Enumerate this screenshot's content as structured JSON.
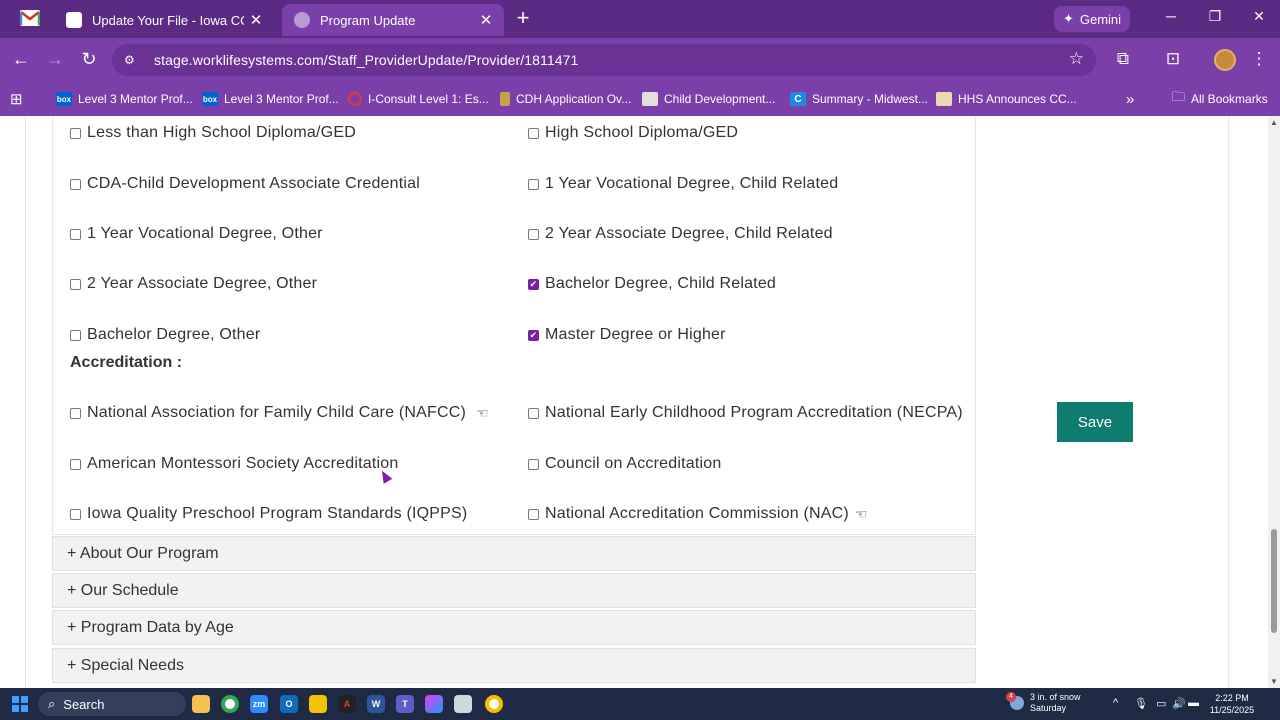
{
  "browser": {
    "tabs": [
      {
        "title": "Update Your File - Iowa CCR&R",
        "active": false
      },
      {
        "title": "Program Update",
        "active": true
      }
    ],
    "gemini_label": "Gemini",
    "url": "stage.worklifesystems.com/Staff_ProviderUpdate/Provider/1811471",
    "bookmarks": [
      "Level 3 Mentor Prof...",
      "Level 3 Mentor Prof...",
      "I-Consult Level 1: Es...",
      "CDH Application Ov...",
      "Child Development...",
      "Summary - Midwest...",
      "HHS Announces CC..."
    ],
    "all_bookmarks_label": "All Bookmarks"
  },
  "education": {
    "options": [
      {
        "label": "Less than High School Diploma/GED",
        "checked": false
      },
      {
        "label": "High School Diploma/GED",
        "checked": false
      },
      {
        "label": "CDA-Child Development Associate Credential",
        "checked": false
      },
      {
        "label": "1 Year Vocational Degree, Child Related",
        "checked": false
      },
      {
        "label": "1 Year Vocational Degree, Other",
        "checked": false
      },
      {
        "label": "2 Year Associate Degree, Child Related",
        "checked": false
      },
      {
        "label": "2 Year Associate Degree, Other",
        "checked": false
      },
      {
        "label": "Bachelor Degree, Child Related",
        "checked": true
      },
      {
        "label": "Bachelor Degree, Other",
        "checked": false
      },
      {
        "label": "Master Degree or Higher",
        "checked": true
      }
    ]
  },
  "accreditation": {
    "label": "Accreditation :",
    "options": [
      {
        "label": "National Association for Family Child Care (NAFCC)",
        "checked": false
      },
      {
        "label": "National Early Childhood Program Accreditation (NECPA)",
        "checked": false
      },
      {
        "label": "American Montessori Society Accreditation",
        "checked": false
      },
      {
        "label": "Council on Accreditation",
        "checked": false
      },
      {
        "label": "Iowa Quality Preschool Program Standards (IQPPS)",
        "checked": false
      },
      {
        "label": "National Accreditation Commission (NAC)",
        "checked": false
      }
    ]
  },
  "sections": [
    "+ About Our Program",
    "+ Our Schedule",
    "+ Program Data by Age",
    "+ Special Needs"
  ],
  "save_label": "Save",
  "taskbar": {
    "search_label": "Search",
    "weather": {
      "line1": "3 in. of snow",
      "line2": "Saturday",
      "badge": "4"
    },
    "clock": {
      "time": "2:22 PM",
      "date": "11/25/2025"
    }
  },
  "colors": {
    "chrome": "#7a3fa8",
    "checked": "#7b1fa2",
    "save": "#0e7c6e"
  }
}
